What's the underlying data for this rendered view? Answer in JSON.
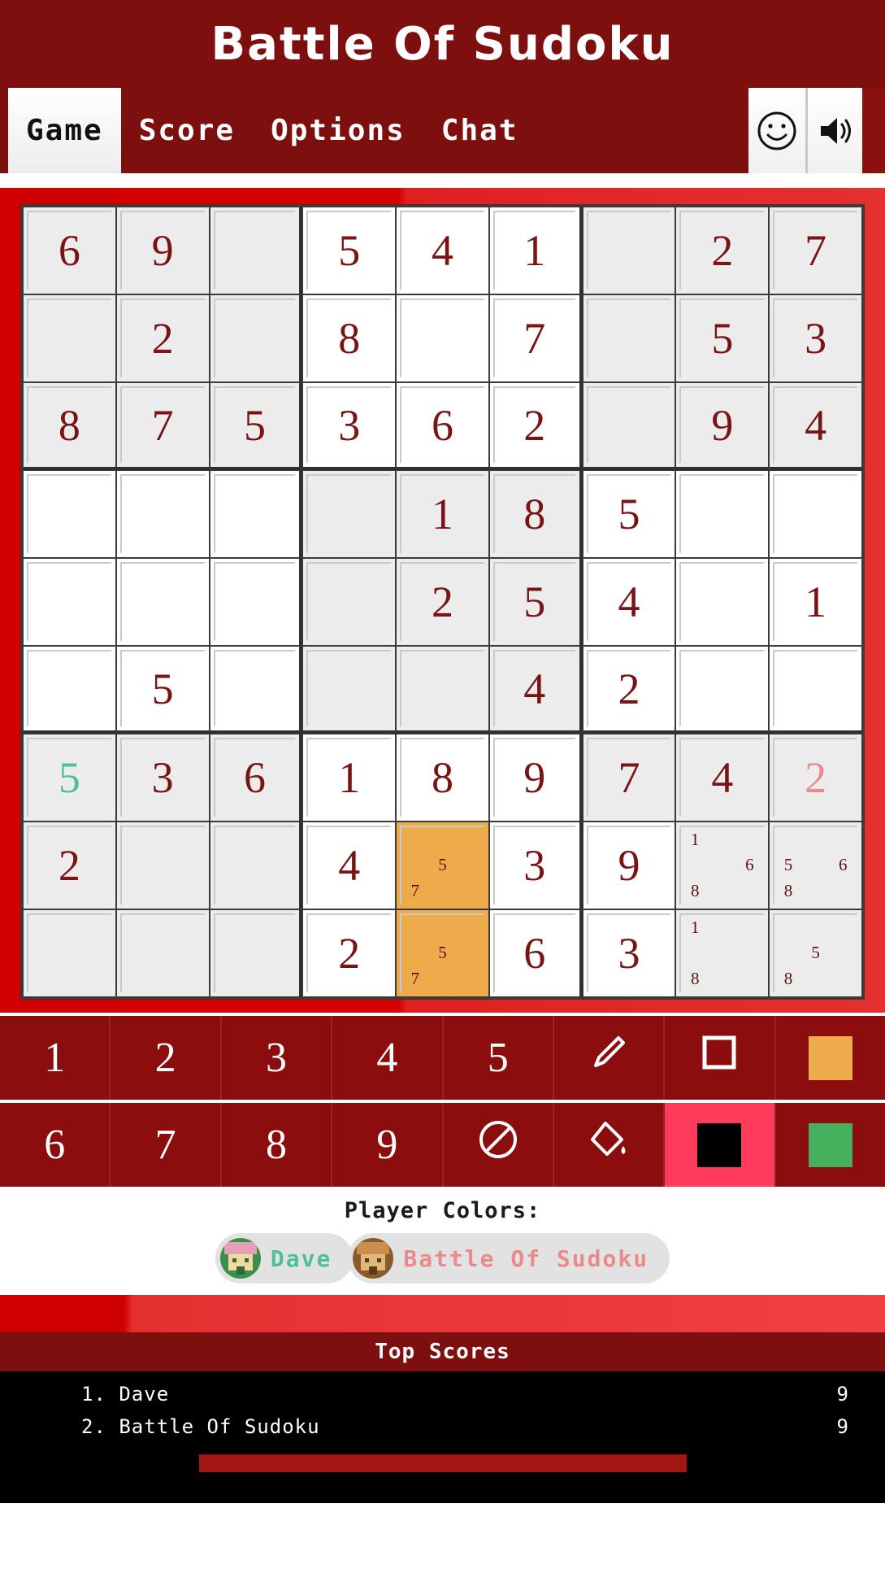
{
  "app": {
    "title": "Battle Of Sudoku"
  },
  "tabs": [
    {
      "label": "Game",
      "active": true
    },
    {
      "label": "Score",
      "active": false
    },
    {
      "label": "Options",
      "active": false
    },
    {
      "label": "Chat",
      "active": false
    }
  ],
  "tab_icons": [
    {
      "name": "smiley-icon",
      "label": "smiley"
    },
    {
      "name": "sound-icon",
      "label": "sound"
    }
  ],
  "board": {
    "cells": [
      [
        {
          "v": "6",
          "bg": "gray"
        },
        {
          "v": "9",
          "bg": "gray"
        },
        {
          "v": "",
          "bg": "gray"
        },
        {
          "v": "5",
          "bg": "white"
        },
        {
          "v": "4",
          "bg": "white"
        },
        {
          "v": "1",
          "bg": "white"
        },
        {
          "v": "",
          "bg": "gray"
        },
        {
          "v": "2",
          "bg": "gray"
        },
        {
          "v": "7",
          "bg": "gray"
        }
      ],
      [
        {
          "v": "",
          "bg": "gray"
        },
        {
          "v": "2",
          "bg": "gray"
        },
        {
          "v": "",
          "bg": "gray"
        },
        {
          "v": "8",
          "bg": "white"
        },
        {
          "v": "",
          "bg": "white"
        },
        {
          "v": "7",
          "bg": "white"
        },
        {
          "v": "",
          "bg": "gray"
        },
        {
          "v": "5",
          "bg": "gray"
        },
        {
          "v": "3",
          "bg": "gray"
        }
      ],
      [
        {
          "v": "8",
          "bg": "gray"
        },
        {
          "v": "7",
          "bg": "gray"
        },
        {
          "v": "5",
          "bg": "gray"
        },
        {
          "v": "3",
          "bg": "white"
        },
        {
          "v": "6",
          "bg": "white"
        },
        {
          "v": "2",
          "bg": "white"
        },
        {
          "v": "",
          "bg": "gray"
        },
        {
          "v": "9",
          "bg": "gray"
        },
        {
          "v": "4",
          "bg": "gray"
        }
      ],
      [
        {
          "v": "",
          "bg": "white"
        },
        {
          "v": "",
          "bg": "white"
        },
        {
          "v": "",
          "bg": "white"
        },
        {
          "v": "",
          "bg": "gray"
        },
        {
          "v": "1",
          "bg": "gray"
        },
        {
          "v": "8",
          "bg": "gray"
        },
        {
          "v": "5",
          "bg": "white"
        },
        {
          "v": "",
          "bg": "white"
        },
        {
          "v": "",
          "bg": "white"
        }
      ],
      [
        {
          "v": "",
          "bg": "white"
        },
        {
          "v": "",
          "bg": "white"
        },
        {
          "v": "",
          "bg": "white"
        },
        {
          "v": "",
          "bg": "gray"
        },
        {
          "v": "2",
          "bg": "gray"
        },
        {
          "v": "5",
          "bg": "gray"
        },
        {
          "v": "4",
          "bg": "white"
        },
        {
          "v": "",
          "bg": "white"
        },
        {
          "v": "1",
          "bg": "white"
        }
      ],
      [
        {
          "v": "",
          "bg": "white"
        },
        {
          "v": "5",
          "bg": "white"
        },
        {
          "v": "",
          "bg": "white"
        },
        {
          "v": "",
          "bg": "gray"
        },
        {
          "v": "",
          "bg": "gray"
        },
        {
          "v": "4",
          "bg": "gray"
        },
        {
          "v": "2",
          "bg": "white"
        },
        {
          "v": "",
          "bg": "white"
        },
        {
          "v": "",
          "bg": "white"
        }
      ],
      [
        {
          "v": "5",
          "bg": "gray",
          "color": "green"
        },
        {
          "v": "3",
          "bg": "gray"
        },
        {
          "v": "6",
          "bg": "gray"
        },
        {
          "v": "1",
          "bg": "white"
        },
        {
          "v": "8",
          "bg": "white"
        },
        {
          "v": "9",
          "bg": "white"
        },
        {
          "v": "7",
          "bg": "gray"
        },
        {
          "v": "4",
          "bg": "gray"
        },
        {
          "v": "2",
          "bg": "gray",
          "color": "pink"
        }
      ],
      [
        {
          "v": "2",
          "bg": "gray"
        },
        {
          "v": "",
          "bg": "gray"
        },
        {
          "v": "",
          "bg": "gray"
        },
        {
          "v": "4",
          "bg": "white"
        },
        {
          "v": "",
          "bg": "orange",
          "notes": [
            "",
            "",
            "",
            "",
            "5",
            "",
            "7",
            "",
            ""
          ]
        },
        {
          "v": "3",
          "bg": "white"
        },
        {
          "v": "9",
          "bg": "white"
        },
        {
          "v": "",
          "bg": "gray",
          "notes": [
            "1",
            "",
            "",
            "",
            "",
            "6",
            "8",
            "",
            ""
          ]
        },
        {
          "v": "",
          "bg": "gray",
          "notes": [
            "",
            "",
            "",
            "5",
            "",
            "6",
            "8",
            "",
            ""
          ]
        }
      ],
      [
        {
          "v": "",
          "bg": "gray"
        },
        {
          "v": "",
          "bg": "gray"
        },
        {
          "v": "",
          "bg": "gray"
        },
        {
          "v": "2",
          "bg": "white"
        },
        {
          "v": "",
          "bg": "orange",
          "notes": [
            "",
            "",
            "",
            "",
            "5",
            "",
            "7",
            "",
            ""
          ]
        },
        {
          "v": "6",
          "bg": "white"
        },
        {
          "v": "3",
          "bg": "white"
        },
        {
          "v": "",
          "bg": "gray",
          "notes": [
            "1",
            "",
            "",
            "",
            "",
            "",
            "8",
            "",
            ""
          ]
        },
        {
          "v": "",
          "bg": "gray",
          "notes": [
            "",
            "",
            "",
            "",
            "5",
            "",
            "8",
            "",
            ""
          ]
        }
      ]
    ]
  },
  "numpad": {
    "row1": [
      {
        "kind": "num",
        "label": "1",
        "name": "numpad-1"
      },
      {
        "kind": "num",
        "label": "2",
        "name": "numpad-2"
      },
      {
        "kind": "num",
        "label": "3",
        "name": "numpad-3"
      },
      {
        "kind": "num",
        "label": "4",
        "name": "numpad-4"
      },
      {
        "kind": "num",
        "label": "5",
        "name": "numpad-5"
      },
      {
        "kind": "icon",
        "label": "pencil-icon",
        "name": "pencil-tool-button"
      },
      {
        "kind": "icon",
        "label": "square-outline-icon",
        "name": "square-tool-button"
      },
      {
        "kind": "swatch",
        "label": "orange-swatch",
        "name": "color-swatch-orange",
        "color": "#eeab4c"
      }
    ],
    "row2": [
      {
        "kind": "num",
        "label": "6",
        "name": "numpad-6"
      },
      {
        "kind": "num",
        "label": "7",
        "name": "numpad-7"
      },
      {
        "kind": "num",
        "label": "8",
        "name": "numpad-8"
      },
      {
        "kind": "num",
        "label": "9",
        "name": "numpad-9"
      },
      {
        "kind": "icon",
        "label": "no-entry-icon",
        "name": "erase-tool-button"
      },
      {
        "kind": "icon",
        "label": "paint-bucket-icon",
        "name": "fill-tool-button"
      },
      {
        "kind": "swatch",
        "label": "black-swatch",
        "name": "color-swatch-black",
        "color": "#000000",
        "selected": true
      },
      {
        "kind": "swatch",
        "label": "green-swatch",
        "name": "color-swatch-green",
        "color": "#47b05e"
      }
    ]
  },
  "player_colors": {
    "title": "Player Colors:",
    "players": [
      {
        "name": "Dave",
        "color": "#4ebf9a"
      },
      {
        "name": "Battle Of Sudoku",
        "color": "#eb8a8a"
      }
    ]
  },
  "top_scores": {
    "header": "Top Scores",
    "rows": [
      {
        "rank": "1. Dave",
        "score": "9"
      },
      {
        "rank": "2. Battle Of Sudoku",
        "score": "9"
      }
    ]
  },
  "colors": {
    "brand_dark_red": "#7d0f0f",
    "brand_red": "#d00000",
    "cell_text": "#7a1313",
    "highlight_orange": "#eeab4c",
    "player_teal": "#4ebf9a",
    "player_pink": "#eb8a8a"
  }
}
